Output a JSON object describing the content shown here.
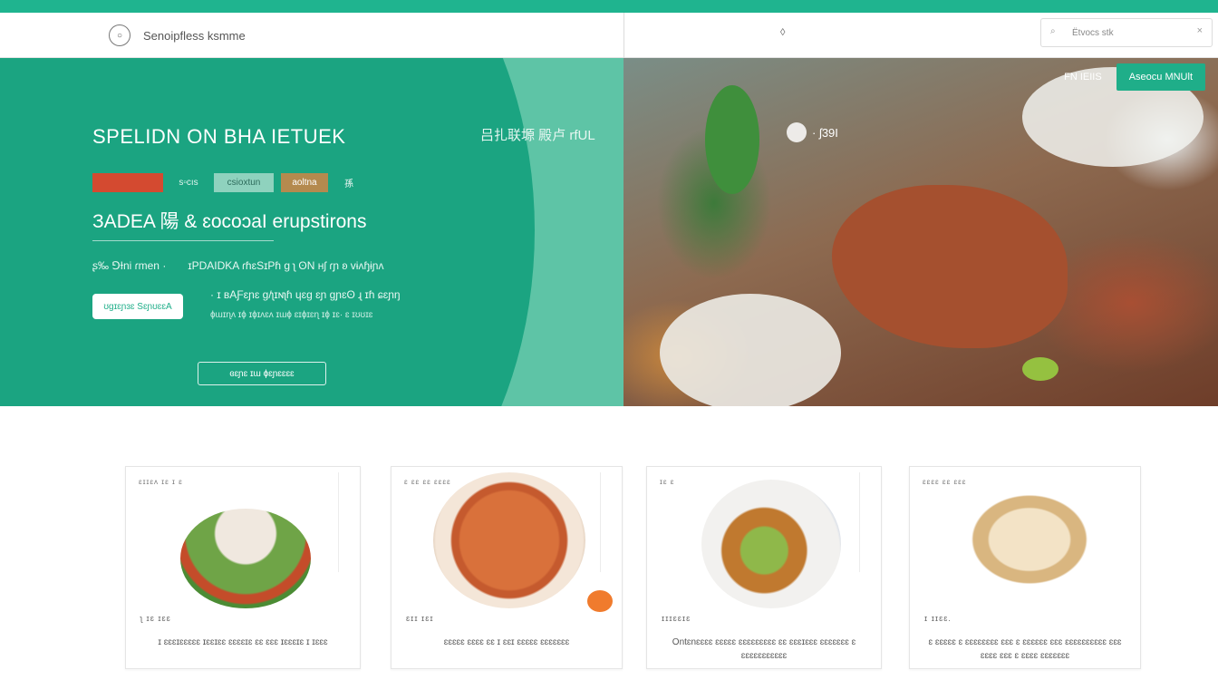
{
  "navbar": {
    "brand": "Senoipfless ksmme",
    "logo_glyph": "○",
    "center_glyph": "◊",
    "search_placeholder": "Ëtvocs stk"
  },
  "hero": {
    "title": "SPELIDN ON BHA IETUEK",
    "title_right": "吕扎联塬  殿卢 rf‌UL",
    "mid_label": "· ʃ39I",
    "top_ghost": "FN IEIIS",
    "top_primary": "Aseocu MNUlt ",
    "chips": [
      "",
      "s▫cıs",
      "csioxtun",
      "aoltna",
      "孫 "
    ],
    "subtitle": "ЗADEA 陽 & ɛocoɔaI erupstirons",
    "meta_left": "ʂ‰ ⅁Ɨni ɾmen ·",
    "meta_right": "ɪPDAIDKA ɾɦɛSɪPɦ ɡ ʅ ʘN ʜʃ ɾɲ ʚ vɨʌɧɨɲʌ",
    "pill": "ʊɡɪɛɲɜɛ SɛɲʊɛɛA",
    "line2": "· ɪ ʙAƑɛɲɛ ɡ/ʅɪɴʅɦ ɥɛɡ ɛɲ ɡɲɛʘ ɻ ɪɦ ɕɛɲŋ",
    "small": "ɸɯɪɳʌ ɪɸ ɪɸɪʌɛʌ ɪɯɸ ɛɪɸɪɛɳ ɪɸ ɪɛ· ɛ ɪʊʊɪɛ",
    "outline_button": "ɞɛɲɛ ɪɯ  ɸɛɲɛɛɛɛ"
  },
  "cards": [
    {
      "tag": "ɛɪɪɛʌ ɪɛ ɪ ɛ",
      "badge": "ʅ ɪɛ ɪɛɛ",
      "desc": "ɪ ɛɛɛɪɛɛɛɛɛ ɪɛɛɪɛɛ ɛɛɛɛɪɛ ɛɛ ɛɛɛ ɪɛɛɛɪɛ ɪ ɪɛɛɛ"
    },
    {
      "tag": "ɛ ɛɛ ɛɛ ɛɛɛɛ",
      "badge": "ɛɪɪ ɪɛɪ",
      "desc": "ɛɛɛɛɛ ɛɛɛɛ ɛɛ ɪ ɛɛɪ ɛɛɛɛɛ ɛɛɛɛɛɛɛ"
    },
    {
      "tag": "ɪɛ ɛ",
      "badge": "ɪɪɪɛɛɪɛ",
      "desc": "Ontɛnɛɛɛɛ ɛɛɛɛɛ ɛɛɛɛɛɛɛɛɛ ɛɛ ɛɛɛɪɛɛɛ ɛɛɛɛɛɛɛ ɛ ɛɛɛɛɛɛɛɛɛɛɛ"
    },
    {
      "tag": "ɛɛɛɛ ɛɛ ɛɛɛ",
      "badge": "ɪ ɪɪɛɛ.",
      "desc": "ɛ ɛɛɛɛɛ ɛ ɛɛɛɛɛɛɛɛ ɛɛɛ ɛ ɛɛɛɛɛɛ ɛɛɛ ɛɛɛɛɛɛɛɛɛɛ ɛɛɛ ɛɛɛɛ ɛɛɛ ɛ ɛɛɛɛ ɛɛɛɛɛɛɛ"
    }
  ],
  "colors": {
    "accent": "#1fae89",
    "chip_red": "#d44a30",
    "chip_brown": "#b48a4e",
    "orange": "#f07b2d"
  }
}
